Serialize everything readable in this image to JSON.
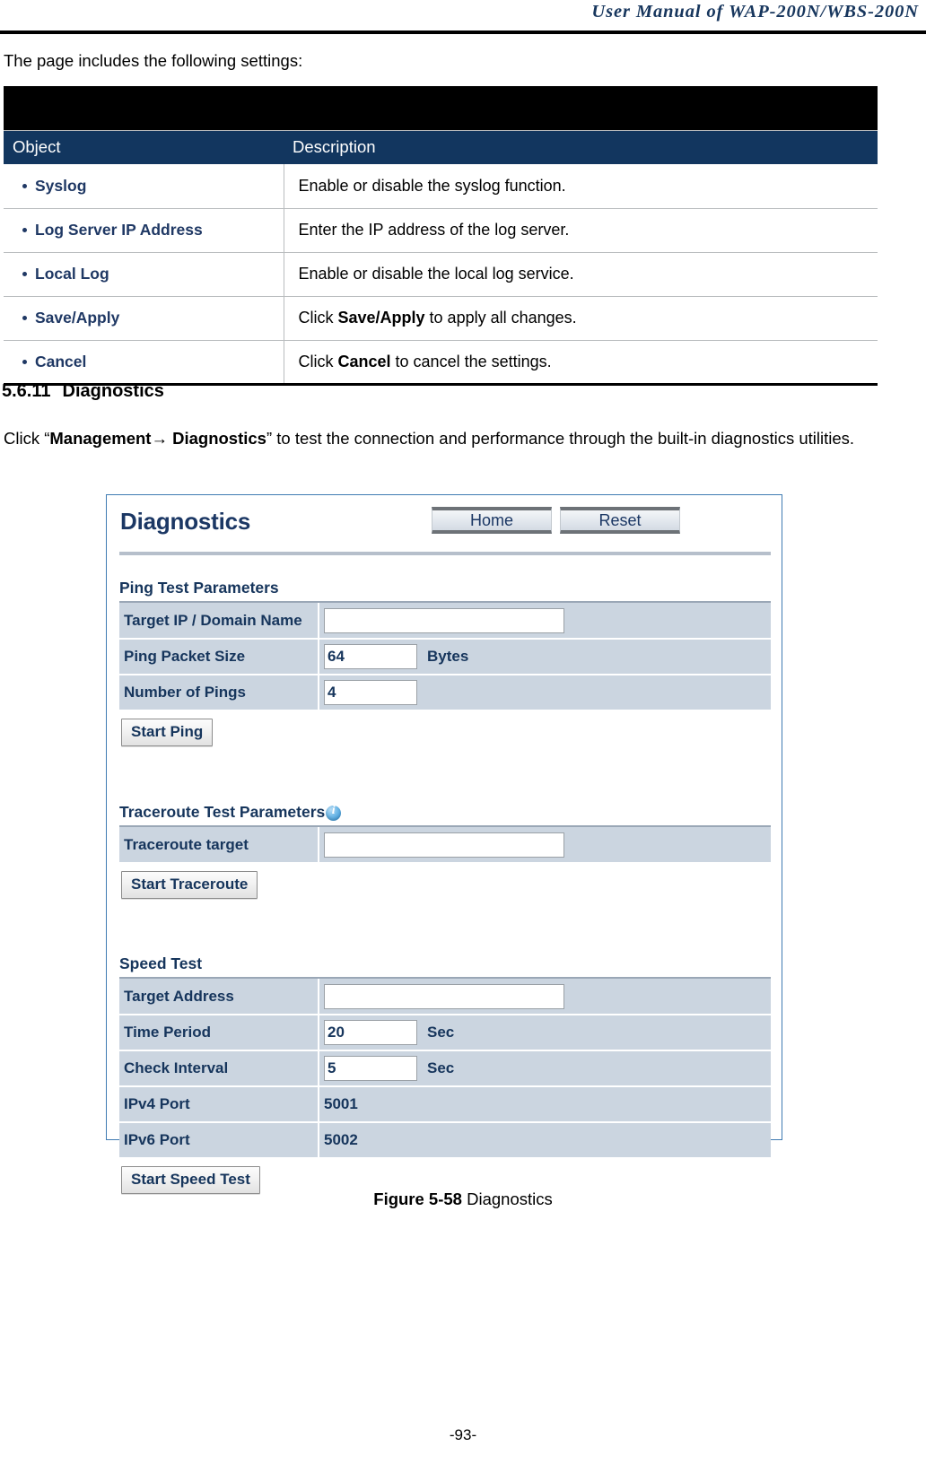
{
  "header": {
    "manual_title": "User Manual of WAP-200N/WBS-200N"
  },
  "intro": {
    "text": "The page includes the following settings:"
  },
  "settings_table": {
    "columns": [
      "Object",
      "Description"
    ],
    "rows": [
      {
        "object": "Syslog",
        "desc_prefix": "Enable or disable the syslog function.",
        "desc_bold": "",
        "desc_suffix": ""
      },
      {
        "object": "Log Server IP Address",
        "desc_prefix": "Enter the IP address of the log server.",
        "desc_bold": "",
        "desc_suffix": ""
      },
      {
        "object": "Local Log",
        "desc_prefix": "Enable or disable the local log service.",
        "desc_bold": "",
        "desc_suffix": ""
      },
      {
        "object": "Save/Apply",
        "desc_prefix": "Click ",
        "desc_bold": "Save/Apply",
        "desc_suffix": " to apply all changes."
      },
      {
        "object": "Cancel",
        "desc_prefix": "Click ",
        "desc_bold": "Cancel",
        "desc_suffix": " to cancel the settings."
      }
    ]
  },
  "section": {
    "number": "5.6.11",
    "title": "Diagnostics",
    "paragraph": {
      "lead": "Click “",
      "bold1": "Management",
      "arrow": "→",
      "bold2": "Diagnostics",
      "tail": "” to test the connection and performance through the built-in diagnostics utilities."
    }
  },
  "device_panel": {
    "title": "Diagnostics",
    "buttons": {
      "home": "Home",
      "reset": "Reset"
    },
    "ping_section": {
      "heading": "Ping Test Parameters",
      "rows": [
        {
          "label": "Target IP / Domain Name",
          "value": "",
          "unit": "",
          "input": "wide"
        },
        {
          "label": "Ping Packet Size",
          "value": "64",
          "unit": "Bytes",
          "input": "narrow"
        },
        {
          "label": "Number of Pings",
          "value": "4",
          "unit": "",
          "input": "narrow"
        }
      ],
      "button": "Start Ping"
    },
    "traceroute_section": {
      "heading": "Traceroute Test Parameters",
      "info_icon": "info-icon",
      "rows": [
        {
          "label": "Traceroute target",
          "value": "",
          "unit": "",
          "input": "wide"
        }
      ],
      "button": "Start Traceroute"
    },
    "speed_section": {
      "heading": "Speed Test",
      "rows": [
        {
          "label": "Target Address",
          "value": "",
          "unit": "",
          "input": "wide"
        },
        {
          "label": "Time Period",
          "value": "20",
          "unit": "Sec",
          "input": "narrow"
        },
        {
          "label": "Check Interval",
          "value": "5",
          "unit": "Sec",
          "input": "narrow"
        },
        {
          "label": "IPv4 Port",
          "value": "5001",
          "unit": "",
          "input": "static"
        },
        {
          "label": "IPv6 Port",
          "value": "5002",
          "unit": "",
          "input": "static"
        }
      ],
      "button": "Start Speed Test"
    }
  },
  "figure": {
    "label": "Figure 5-58",
    "caption": " Diagnostics"
  },
  "footer": {
    "page_number": "-93-"
  },
  "colors": {
    "brand_navy": "#12365F",
    "label_navy": "#1F3864",
    "panel_border": "#3F7BB2",
    "row_bg": "#CBD5E0"
  }
}
